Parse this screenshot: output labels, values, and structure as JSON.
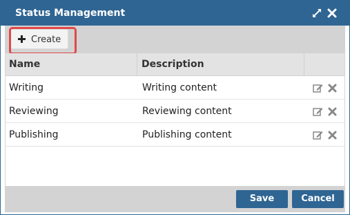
{
  "dialog": {
    "title": "Status Management",
    "maximize_icon": "maximize-icon",
    "close_icon": "close-icon",
    "accent_color": "#2f6593",
    "highlight_color": "#e04848"
  },
  "toolbar": {
    "create_label": "Create",
    "create_icon": "plus-icon"
  },
  "table": {
    "columns": [
      "Name",
      "Description"
    ],
    "rows": [
      {
        "name": "Writing",
        "description": "Writing content"
      },
      {
        "name": "Reviewing",
        "description": "Reviewing content"
      },
      {
        "name": "Publishing",
        "description": "Publishing content"
      }
    ],
    "row_actions": [
      "edit-icon",
      "delete-icon"
    ]
  },
  "footer": {
    "save_label": "Save",
    "cancel_label": "Cancel"
  }
}
